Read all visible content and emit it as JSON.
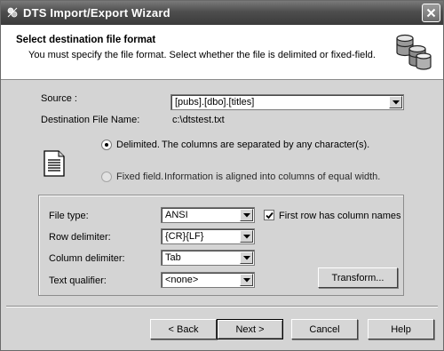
{
  "window": {
    "title": "DTS Import/Export Wizard"
  },
  "header": {
    "title": "Select destination file format",
    "subtitle": "You must specify the file format. Select whether the file is delimited or fixed-field."
  },
  "source": {
    "label": "Source :",
    "value": "[pubs].[dbo].[titles]"
  },
  "destination": {
    "label": "Destination File Name:",
    "value": "c:\\dtstest.txt"
  },
  "format_options": {
    "delimited": {
      "label": "Delimited.",
      "description": "The columns are separated by any character(s).",
      "selected": true
    },
    "fixed": {
      "label": "Fixed field.",
      "description": "Information is aligned into columns of equal width.",
      "selected": false
    }
  },
  "fields": {
    "file_type": {
      "label": "File type:",
      "value": "ANSI"
    },
    "row_delimiter": {
      "label": "Row delimiter:",
      "value": "{CR}{LF}"
    },
    "column_delimiter": {
      "label": "Column delimiter:",
      "value": "Tab"
    },
    "text_qualifier": {
      "label": "Text qualifier:",
      "value": "<none>"
    }
  },
  "first_row": {
    "label": "First row has column names",
    "checked": true
  },
  "buttons": {
    "transform": "Transform...",
    "back": "< Back",
    "next": "Next >",
    "cancel": "Cancel",
    "help": "Help"
  },
  "colors": {
    "titlebar": "#4e4e4e",
    "dialog": "#d4d4d4",
    "header": "#ffffff"
  },
  "icons": [
    "wizard-app-icon",
    "close-icon",
    "database-icon",
    "document-icon",
    "dropdown-arrow-icon",
    "checkmark-icon"
  ]
}
